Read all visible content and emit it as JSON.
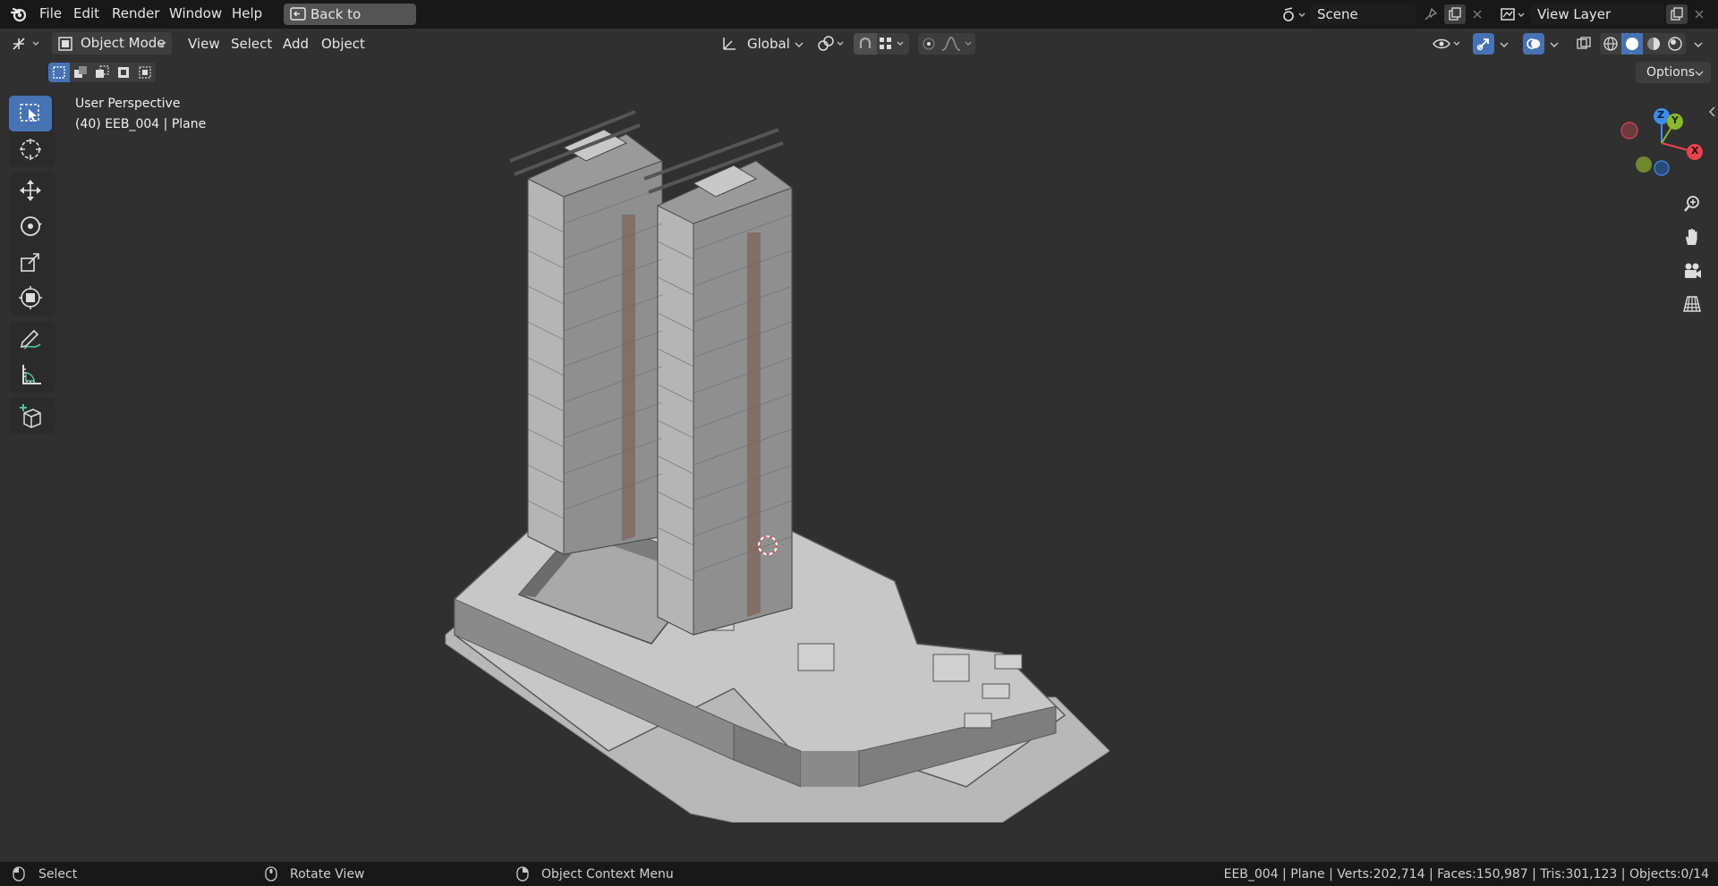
{
  "topbar": {
    "menu": [
      "File",
      "Edit",
      "Render",
      "Window",
      "Help"
    ],
    "back_button": "Back to Previous",
    "scene_name": "Scene",
    "view_layer": "View Layer"
  },
  "header": {
    "mode": "Object Mode",
    "menus": [
      "View",
      "Select",
      "Add",
      "Object"
    ],
    "transform_orientation": "Global"
  },
  "row2": {
    "options_label": "Options"
  },
  "viewport": {
    "perspective_label": "User Perspective",
    "object_label": "(40) EEB_004 | Plane",
    "axes": {
      "x": "X",
      "y": "Y",
      "z": "Z"
    }
  },
  "statusbar": {
    "select": "Select",
    "rotate": "Rotate View",
    "context_menu": "Object Context Menu",
    "stats": "EEB_004 | Plane | Verts:202,714 | Faces:150,987 | Tris:301,123 | Objects:0/14"
  },
  "colors": {
    "accent": "#4772b3",
    "axis_x": "#e84250",
    "axis_y": "#8bb82c",
    "axis_z": "#3d8cf0"
  }
}
